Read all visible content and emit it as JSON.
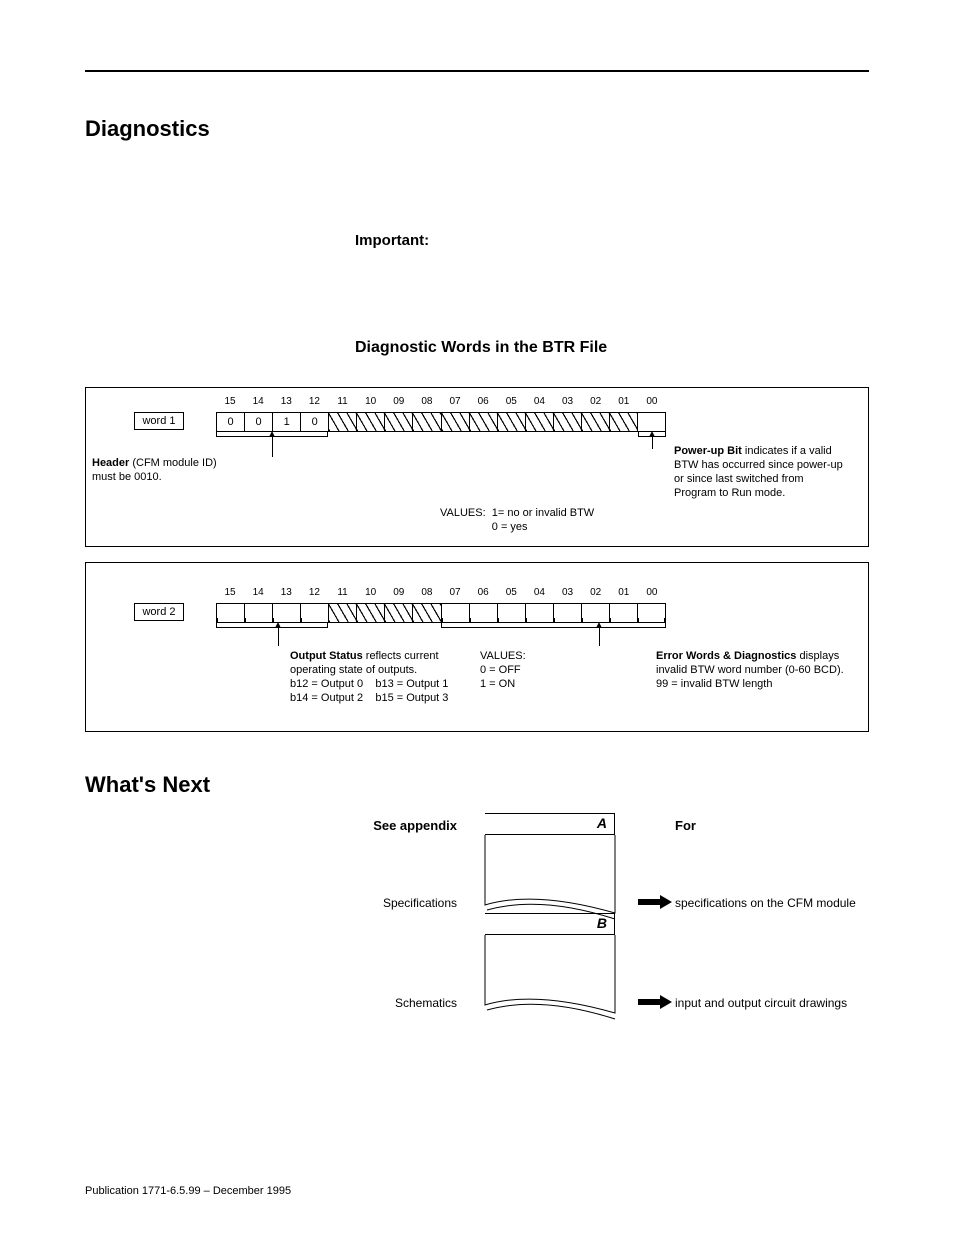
{
  "headings": {
    "h1": "Diagnostics",
    "important": "Important:",
    "h2": "Diagnostic Words in the BTR File",
    "next": "What's Next"
  },
  "bits": [
    "15",
    "14",
    "13",
    "12",
    "11",
    "10",
    "09",
    "08",
    "07",
    "06",
    "05",
    "04",
    "03",
    "02",
    "01",
    "00"
  ],
  "word1": {
    "label": "word 1",
    "header_bits": [
      "0",
      "0",
      "1",
      "0"
    ],
    "header_bold": "Header",
    "header_rest": " (CFM module ID) must be 0010.",
    "powerup_bold": "Power-up Bit",
    "powerup_rest": " indicates if a valid BTW has occurred since power-up or since last switched from Program to Run mode.",
    "values_label": "VALUES:",
    "values_1": "1= no or invalid BTW",
    "values_0": "0 = yes"
  },
  "word2": {
    "label": "word 2",
    "out_bold": "Output Status",
    "out_rest": " reflects current operating state of outputs.",
    "out_b12": "b12 = Output 0",
    "out_b13": "b13 = Output 1",
    "out_b14": "b14 = Output 2",
    "out_b15": "b15 = Output 3",
    "values_label": "VALUES:",
    "values_0": "0 = OFF",
    "values_1": "1 = ON",
    "err_bold": "Error Words & Diagnostics",
    "err_rest": " displays invalid BTW word number (0-60 BCD). 99 = invalid BTW length"
  },
  "appendix": {
    "see": "See appendix",
    "forcol": "For",
    "rows": [
      {
        "letter": "A",
        "label": "Specifications",
        "for": "specifications on the CFM module"
      },
      {
        "letter": "B",
        "label": "Schematics",
        "for": "input and output circuit drawings"
      }
    ]
  },
  "footer": "Publication 1771-6.5.99 – December 1995"
}
